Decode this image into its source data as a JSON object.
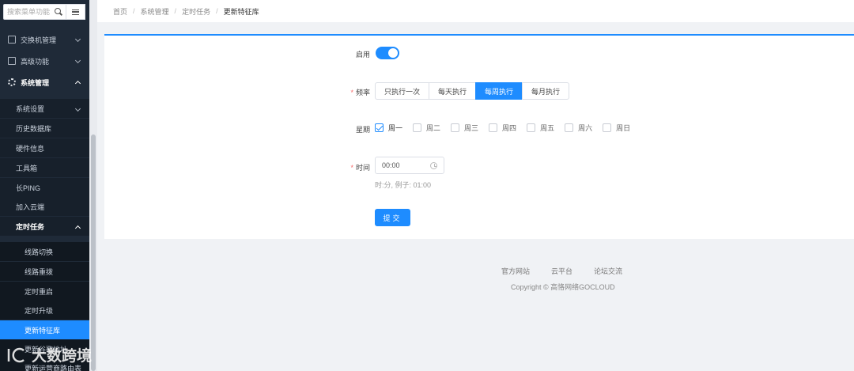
{
  "sidebar": {
    "search_placeholder": "搜索菜单功能",
    "items": [
      {
        "label": "交换机管理"
      },
      {
        "label": "高级功能"
      },
      {
        "label": "系统管理"
      }
    ],
    "system_sub": [
      {
        "label": "系统设置"
      },
      {
        "label": "历史数据库"
      },
      {
        "label": "硬件信息"
      },
      {
        "label": "工具箱"
      },
      {
        "label": "长PING"
      },
      {
        "label": "加入云端"
      },
      {
        "label": "定时任务"
      }
    ],
    "task_sub": [
      {
        "label": "线路切换"
      },
      {
        "label": "线路重拨"
      },
      {
        "label": "定时重启"
      },
      {
        "label": "定时升级"
      },
      {
        "label": "更新特征库"
      },
      {
        "label": "更新谷歌地址"
      },
      {
        "label": "更新运营商路由表"
      }
    ]
  },
  "breadcrumb": [
    "首页",
    "系统管理",
    "定时任务",
    "更新特征库"
  ],
  "form": {
    "enable_label": "启用",
    "enabled": true,
    "frequency_label": "频率",
    "frequency_options": [
      "只执行一次",
      "每天执行",
      "每周执行",
      "每月执行"
    ],
    "frequency_selected": "每周执行",
    "weekday_label": "星期",
    "weekdays": [
      {
        "label": "周一",
        "checked": true
      },
      {
        "label": "周二",
        "checked": false
      },
      {
        "label": "周三",
        "checked": false
      },
      {
        "label": "周四",
        "checked": false
      },
      {
        "label": "周五",
        "checked": false
      },
      {
        "label": "周六",
        "checked": false
      },
      {
        "label": "周日",
        "checked": false
      }
    ],
    "time_label": "时间",
    "time_value": "00:00",
    "time_hint": "时:分, 例子: 01:00",
    "submit_label": "提交"
  },
  "footer": {
    "links": [
      "官方网站",
      "云平台",
      "论坛交流"
    ],
    "copyright": "Copyright © 高恪网络GOCLOUD"
  },
  "watermark": "大数跨境",
  "colors": {
    "accent": "#1e8cff",
    "sidebar_bg": "#1f2a38",
    "required": "#f56c6c"
  }
}
